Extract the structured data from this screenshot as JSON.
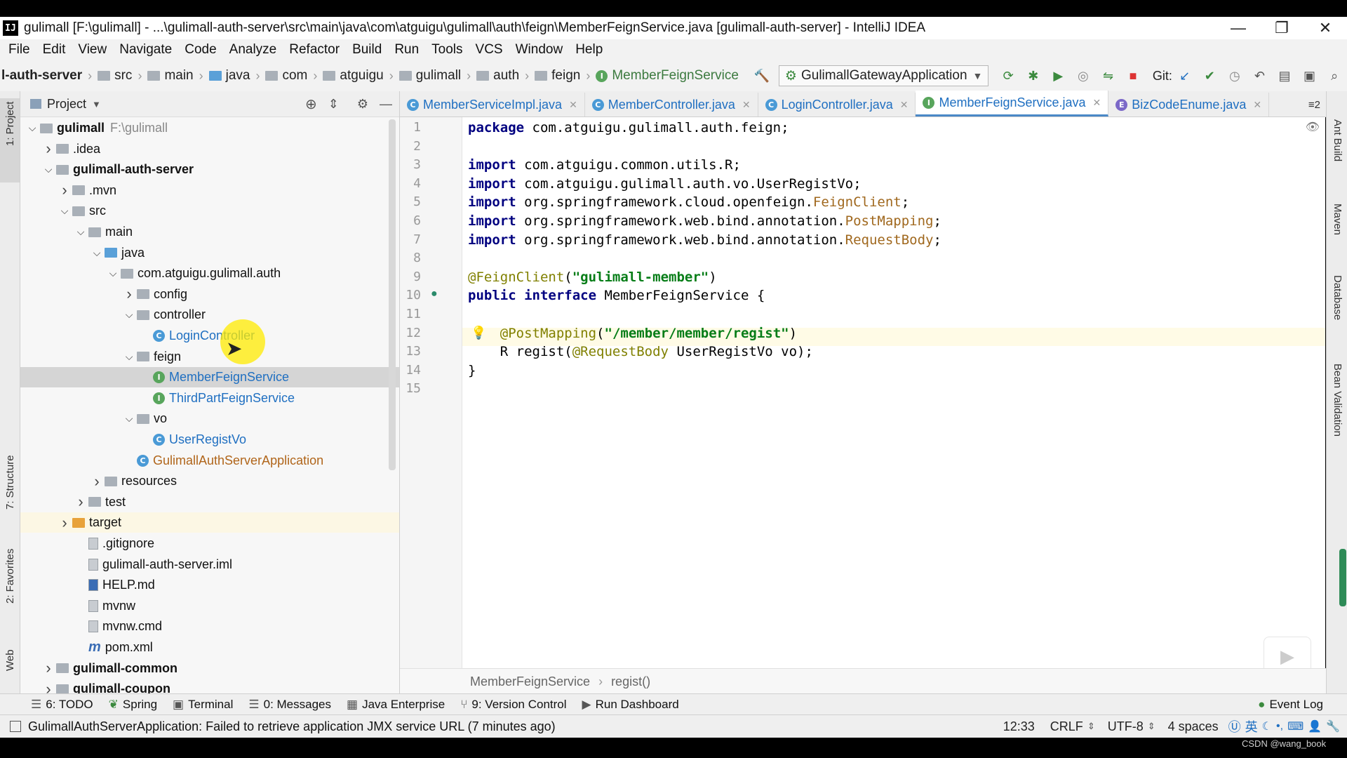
{
  "window": {
    "title": "gulimall [F:\\gulimall] - ...\\gulimall-auth-server\\src\\main\\java\\com\\atguigu\\gulimall\\auth\\feign\\MemberFeignService.java [gulimall-auth-server] - IntelliJ IDEA",
    "app_icon": "IJ",
    "minimize": "—",
    "restore": "❐",
    "close": "✕"
  },
  "menu": [
    "File",
    "Edit",
    "View",
    "Navigate",
    "Code",
    "Analyze",
    "Refactor",
    "Build",
    "Run",
    "Tools",
    "VCS",
    "Window",
    "Help"
  ],
  "nav": {
    "crumbs": [
      "l-auth-server",
      "src",
      "main",
      "java",
      "com",
      "atguigu",
      "gulimall",
      "auth",
      "feign",
      "MemberFeignService"
    ],
    "run_config": "GulimallGatewayApplication",
    "git_label": "Git:"
  },
  "left_strip": {
    "project": "1: Project",
    "structure": "7: Structure",
    "favorites": "2: Favorites",
    "web": "Web"
  },
  "right_strip": {
    "ant": "Ant Build",
    "maven": "Maven",
    "database": "Database",
    "bean": "Bean Validation"
  },
  "project_panel": {
    "title": "Project",
    "root_path": "F:\\gulimall"
  },
  "tree": [
    {
      "label": "gulimall",
      "bold": true,
      "indent": 0,
      "arrow": "v",
      "icon": "folder"
    },
    {
      "label": ".idea",
      "indent": 1,
      "arrow": ">",
      "icon": "folder"
    },
    {
      "label": "gulimall-auth-server",
      "bold": true,
      "indent": 1,
      "arrow": "v",
      "icon": "folder"
    },
    {
      "label": ".mvn",
      "indent": 2,
      "arrow": ">",
      "icon": "folder"
    },
    {
      "label": "src",
      "indent": 2,
      "arrow": "v",
      "icon": "folder"
    },
    {
      "label": "main",
      "indent": 3,
      "arrow": "v",
      "icon": "folder"
    },
    {
      "label": "java",
      "indent": 4,
      "arrow": "v",
      "icon": "folder-blue"
    },
    {
      "label": "com.atguigu.gulimall.auth",
      "indent": 5,
      "arrow": "v",
      "icon": "folder"
    },
    {
      "label": "config",
      "indent": 6,
      "arrow": ">",
      "icon": "folder"
    },
    {
      "label": "controller",
      "indent": 6,
      "arrow": "v",
      "icon": "folder"
    },
    {
      "label": "LoginController",
      "indent": 7,
      "arrow": "",
      "icon": "class",
      "link": true
    },
    {
      "label": "feign",
      "indent": 6,
      "arrow": "v",
      "icon": "folder"
    },
    {
      "label": "MemberFeignService",
      "indent": 7,
      "arrow": "",
      "icon": "interface",
      "link": true,
      "selected": true
    },
    {
      "label": "ThirdPartFeignService",
      "indent": 7,
      "arrow": "",
      "icon": "interface",
      "link": true
    },
    {
      "label": "vo",
      "indent": 6,
      "arrow": "v",
      "icon": "folder"
    },
    {
      "label": "UserRegistVo",
      "indent": 7,
      "arrow": "",
      "icon": "class",
      "link": true
    },
    {
      "label": "GulimallAuthServerApplication",
      "indent": 6,
      "arrow": "",
      "icon": "springclass",
      "orange": true
    },
    {
      "label": "resources",
      "indent": 4,
      "arrow": ">",
      "icon": "folder"
    },
    {
      "label": "test",
      "indent": 3,
      "arrow": ">",
      "icon": "folder"
    },
    {
      "label": "target",
      "indent": 2,
      "arrow": ">",
      "icon": "folder-orange",
      "highlight": true
    },
    {
      "label": ".gitignore",
      "indent": 3,
      "arrow": "",
      "icon": "file"
    },
    {
      "label": "gulimall-auth-server.iml",
      "indent": 3,
      "arrow": "",
      "icon": "file"
    },
    {
      "label": "HELP.md",
      "indent": 3,
      "arrow": "",
      "icon": "md"
    },
    {
      "label": "mvnw",
      "indent": 3,
      "arrow": "",
      "icon": "file"
    },
    {
      "label": "mvnw.cmd",
      "indent": 3,
      "arrow": "",
      "icon": "file"
    },
    {
      "label": "pom.xml",
      "indent": 3,
      "arrow": "",
      "icon": "maven"
    },
    {
      "label": "gulimall-common",
      "bold": true,
      "indent": 1,
      "arrow": ">",
      "icon": "folder"
    },
    {
      "label": "gulimall-coupon",
      "bold": true,
      "indent": 1,
      "arrow": ">",
      "icon": "folder"
    }
  ],
  "tabs": [
    {
      "label": "MemberServiceImpl.java",
      "kind": "C"
    },
    {
      "label": "MemberController.java",
      "kind": "C"
    },
    {
      "label": "LoginController.java",
      "kind": "C"
    },
    {
      "label": "MemberFeignService.java",
      "kind": "I",
      "active": true
    },
    {
      "label": "BizCodeEnume.java",
      "kind": "E"
    }
  ],
  "tabs_overflow": "≡2",
  "code_lines": [
    "package com.atguigu.gulimall.auth.feign;",
    "",
    "import com.atguigu.common.utils.R;",
    "import com.atguigu.gulimall.auth.vo.UserRegistVo;",
    "import org.springframework.cloud.openfeign.FeignClient;",
    "import org.springframework.web.bind.annotation.PostMapping;",
    "import org.springframework.web.bind.annotation.RequestBody;",
    "",
    "@FeignClient(\"gulimall-member\")",
    "public interface MemberFeignService {",
    "",
    "    @PostMapping(\"/member/member/regist\")",
    "    R regist(@RequestBody UserRegistVo vo);",
    "}",
    ""
  ],
  "code_breadcrumb": [
    "MemberFeignService",
    "regist()"
  ],
  "toolwindows": [
    "6: TODO",
    "Spring",
    "Terminal",
    "0: Messages",
    "Java Enterprise",
    "9: Version Control",
    "Run Dashboard"
  ],
  "event_log": "Event Log",
  "status": {
    "message": "GulimallAuthServerApplication: Failed to retrieve application JMX service URL (7 minutes ago)",
    "position": "12:33",
    "line_sep": "CRLF",
    "encoding": "UTF-8",
    "indent": "4 spaces",
    "ime": "英"
  },
  "watermark": "CSDN @wang_book"
}
